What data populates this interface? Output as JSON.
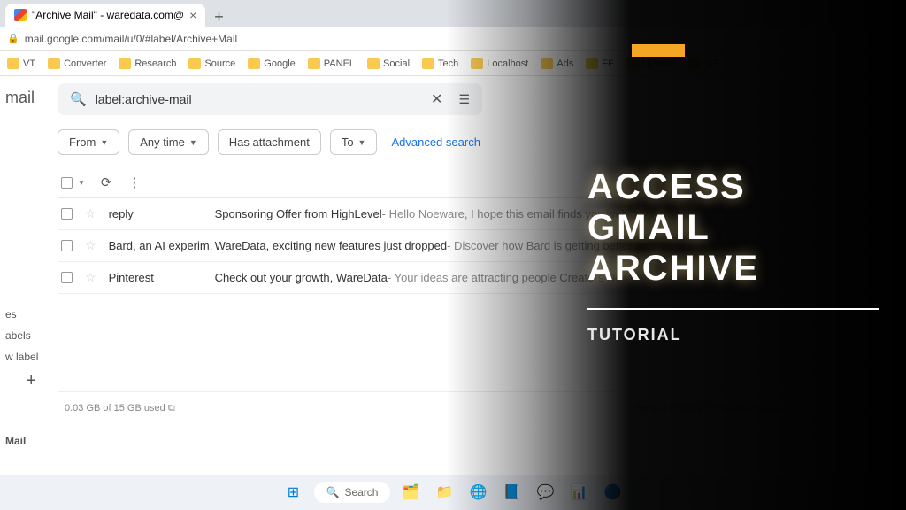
{
  "browser": {
    "tab_title": "\"Archive Mail\" - waredata.com@",
    "url": "mail.google.com/mail/u/0/#label/Archive+Mail"
  },
  "bookmarks": [
    "VT",
    "Converter",
    "Research",
    "Source",
    "Google",
    "PANEL",
    "Social",
    "Tech",
    "Localhost",
    "Ads",
    "FF",
    "Upwork",
    "SG"
  ],
  "sidebar": {
    "logo": "mail",
    "labels": [
      "es",
      "abels",
      "w label"
    ],
    "bottom": "Mail"
  },
  "search": {
    "value": "label:archive-mail"
  },
  "filters": {
    "from": "From",
    "anytime": "Any time",
    "attachment": "Has attachment",
    "to": "To",
    "advanced": "Advanced search"
  },
  "emails": [
    {
      "sender": "reply",
      "subject": "Sponsoring Offer from HighLevel",
      "preview": " - Hello Noeware, I hope this email finds you well. My name is"
    },
    {
      "sender": "Bard, an AI experim.",
      "subject": "WareData, exciting new features just dropped",
      "preview": " - Discover how Bard is getting better and"
    },
    {
      "sender": "Pinterest",
      "subject": "Check out your growth, WareData",
      "preview": " - Your ideas are attracting people Creators New Pin"
    }
  ],
  "footer": {
    "storage": "0.03 GB of 15 GB used",
    "links": "Terms · Privacy · Program Policies"
  },
  "taskbar": {
    "search": "Search"
  },
  "overlay": {
    "line1": "ACCESS",
    "line2": "GMAIL",
    "line3": "ARCHIVE",
    "subtitle": "TUTORIAL"
  }
}
